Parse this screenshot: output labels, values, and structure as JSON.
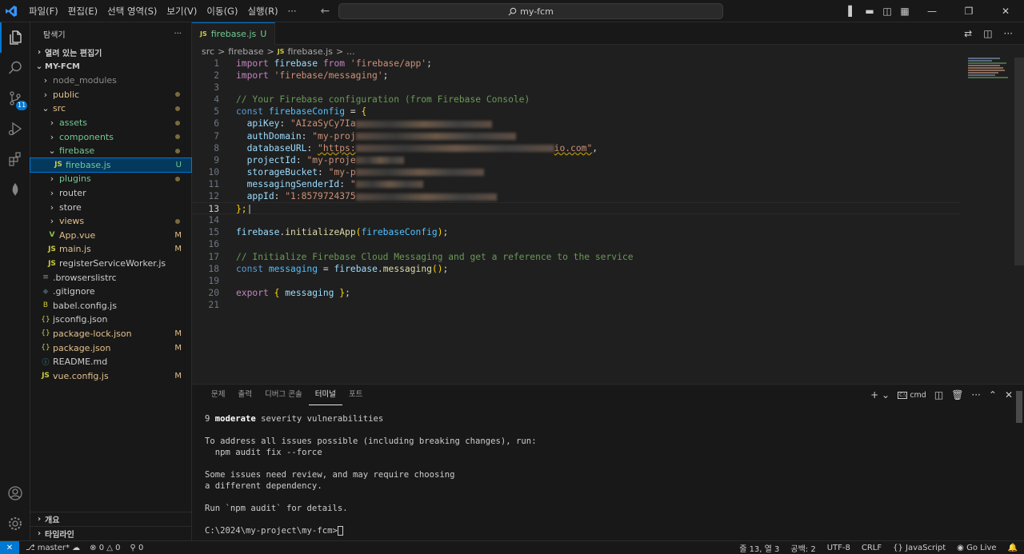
{
  "titlebar": {
    "menu": [
      "파일(F)",
      "편집(E)",
      "선택 영역(S)",
      "보기(V)",
      "이동(G)",
      "실행(R)",
      "···"
    ],
    "search_text": "my-fcm"
  },
  "activity": {
    "scm_badge": "11"
  },
  "sidebar": {
    "title": "탐색기",
    "more": "···",
    "open_editors": "열려 있는 편집기",
    "project": "MY-FCM",
    "items": [
      {
        "label": "node_modules",
        "indent": 1,
        "type": "folder",
        "open": false,
        "color": "ignored",
        "status": ""
      },
      {
        "label": "public",
        "indent": 1,
        "type": "folder",
        "open": false,
        "color": "mod",
        "status": "dot"
      },
      {
        "label": "src",
        "indent": 1,
        "type": "folder",
        "open": true,
        "color": "mod",
        "status": "dot"
      },
      {
        "label": "assets",
        "indent": 2,
        "type": "folder",
        "open": false,
        "color": "untracked",
        "status": "dot"
      },
      {
        "label": "components",
        "indent": 2,
        "type": "folder",
        "open": false,
        "color": "untracked",
        "status": "dot"
      },
      {
        "label": "firebase",
        "indent": 2,
        "type": "folder",
        "open": true,
        "color": "untracked",
        "status": "dot"
      },
      {
        "label": "firebase.js",
        "indent": 3,
        "type": "js",
        "color": "untracked",
        "status": "U",
        "selected": true
      },
      {
        "label": "plugins",
        "indent": 2,
        "type": "folder",
        "open": false,
        "color": "untracked",
        "status": "dot"
      },
      {
        "label": "router",
        "indent": 2,
        "type": "folder",
        "open": false,
        "color": "normal",
        "status": ""
      },
      {
        "label": "store",
        "indent": 2,
        "type": "folder",
        "open": false,
        "color": "normal",
        "status": ""
      },
      {
        "label": "views",
        "indent": 2,
        "type": "folder",
        "open": false,
        "color": "mod",
        "status": "dot"
      },
      {
        "label": "App.vue",
        "indent": 2,
        "type": "vue",
        "color": "mod",
        "status": "M"
      },
      {
        "label": "main.js",
        "indent": 2,
        "type": "js",
        "color": "mod",
        "status": "M"
      },
      {
        "label": "registerServiceWorker.js",
        "indent": 2,
        "type": "js",
        "color": "normal",
        "status": ""
      },
      {
        "label": ".browserslistrc",
        "indent": 1,
        "type": "file",
        "color": "normal",
        "status": ""
      },
      {
        "label": ".gitignore",
        "indent": 1,
        "type": "git",
        "color": "normal",
        "status": ""
      },
      {
        "label": "babel.config.js",
        "indent": 1,
        "type": "babel",
        "color": "normal",
        "status": ""
      },
      {
        "label": "jsconfig.json",
        "indent": 1,
        "type": "json",
        "color": "normal",
        "status": ""
      },
      {
        "label": "package-lock.json",
        "indent": 1,
        "type": "json",
        "color": "mod",
        "status": "M"
      },
      {
        "label": "package.json",
        "indent": 1,
        "type": "json",
        "color": "mod",
        "status": "M"
      },
      {
        "label": "README.md",
        "indent": 1,
        "type": "info",
        "color": "normal",
        "status": ""
      },
      {
        "label": "vue.config.js",
        "indent": 1,
        "type": "js",
        "color": "mod",
        "status": "M"
      }
    ],
    "outline": "개요",
    "timeline": "타임라인"
  },
  "editor": {
    "tab_label": "firebase.js",
    "tab_status": "U",
    "breadcrumb": [
      "src",
      ">",
      "firebase",
      ">",
      "firebase.js",
      ">",
      "..."
    ],
    "current_line": 13,
    "lines": [
      "1",
      "2",
      "3",
      "4",
      "5",
      "6",
      "7",
      "8",
      "9",
      "10",
      "11",
      "12",
      "13",
      "14",
      "15",
      "16",
      "17",
      "18",
      "19",
      "20",
      "21"
    ],
    "code": {
      "import1_kw": "import",
      "import1_name": "firebase",
      "import1_from": "from",
      "import1_src": "'firebase/app'",
      "import2_kw": "import",
      "import2_src": "'firebase/messaging'",
      "comment1": "// Your Firebase configuration (from Firebase Console)",
      "const_kw": "const",
      "config_name": "firebaseConfig",
      "apiKey_key": "apiKey",
      "apiKey_val": "\"AIzaSyCy7Ia",
      "authDomain_key": "authDomain",
      "authDomain_val": "\"my-proj",
      "databaseURL_key": "databaseURL",
      "databaseURL_val": "\"https:",
      "databaseURL_tail": "io.com\"",
      "projectId_key": "projectId",
      "projectId_val": "\"my-proje",
      "storageBucket_key": "storageBucket",
      "storageBucket_val": "\"my-p",
      "messagingSenderId_key": "messagingSenderId",
      "messagingSenderId_val": "\"",
      "appId_key": "appId",
      "appId_val": "\"1:8579724375",
      "close": "};",
      "init_obj": "firebase",
      "init_fn": "initializeApp",
      "init_arg": "firebaseConfig",
      "comment2": "// Initialize Firebase Cloud Messaging and get a reference to the service",
      "msg_const": "const",
      "msg_name": "messaging",
      "msg_obj": "firebase",
      "msg_fn": "messaging",
      "export_kw": "export",
      "export_name": "messaging"
    }
  },
  "panel": {
    "tabs": [
      "문제",
      "출력",
      "디버그 콘솔",
      "터미널",
      "포트"
    ],
    "active_tab": "터미널",
    "shell": "cmd",
    "terminal": {
      "l1_num": "9 ",
      "l1_bold": "moderate",
      "l1_rest": " severity vulnerabilities",
      "l2": "To address all issues possible (including breaking changes), run:",
      "l3": "  npm audit fix --force",
      "l4": "Some issues need review, and may require choosing",
      "l5": "a different dependency.",
      "l6": "Run `npm audit` for details.",
      "prompt": "C:\\2024\\my-project\\my-fcm>"
    }
  },
  "statusbar": {
    "branch": "master*",
    "errors": "0",
    "warnings": "0",
    "ports": "0",
    "position": "줄 13, 열 3",
    "spaces": "공백: 2",
    "encoding": "UTF-8",
    "eol": "CRLF",
    "language": "JavaScript",
    "golive": "Go Live"
  }
}
